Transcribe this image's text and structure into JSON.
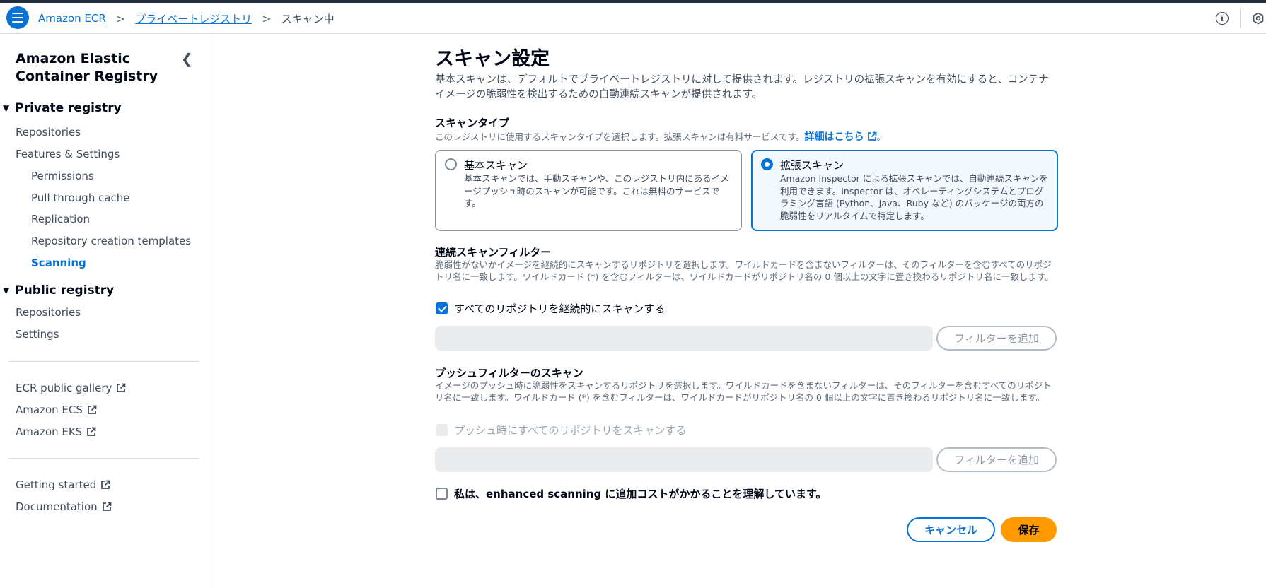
{
  "header": {
    "breadcrumbs": [
      "Amazon ECR",
      "プライベートレジストリ",
      "スキャン中"
    ],
    "separator": ">"
  },
  "sidebar": {
    "title": "Amazon Elastic Container Registry",
    "private_registry": {
      "label": "Private registry",
      "items": [
        "Repositories",
        "Features & Settings"
      ],
      "sub_items": [
        "Permissions",
        "Pull through cache",
        "Replication",
        "Repository creation templates",
        "Scanning"
      ],
      "active": "Scanning"
    },
    "public_registry": {
      "label": "Public registry",
      "items": [
        "Repositories",
        "Settings"
      ]
    },
    "links": [
      "ECR public gallery",
      "Amazon ECS",
      "Amazon EKS"
    ],
    "help_links": [
      "Getting started",
      "Documentation"
    ]
  },
  "main": {
    "title": "スキャン設定",
    "description": "基本スキャンは、デフォルトでプライベートレジストリに対して提供されます。レジストリの拡張スキャンを有効にすると、コンテナイメージの脆弱性を検出するための自動連続スキャンが提供されます。",
    "scan_type": {
      "label": "スキャンタイプ",
      "description": "このレジストリに使用するスキャンタイプを選択します。拡張スキャンは有料サービスです。",
      "learn_more": "詳細はこちら",
      "trailing": "。",
      "options": [
        {
          "title": "基本スキャン",
          "description": "基本スキャンでは、手動スキャンや、このレジストリ内にあるイメージプッシュ時のスキャンが可能です。これは無料のサービスです。",
          "selected": false
        },
        {
          "title": "拡張スキャン",
          "description": "Amazon Inspector による拡張スキャンでは、自動連続スキャンを利用できます。Inspector は、オペレーティングシステムとプログラミング言語 (Python、Java、Ruby など) のパッケージの両方の脆弱性をリアルタイムで特定します。",
          "selected": true
        }
      ]
    },
    "continuous_filter": {
      "label": "連続スキャンフィルター",
      "description": "脆弱性がないかイメージを継続的にスキャンするリポジトリを選択します。ワイルドカードを含まないフィルターは、そのフィルターを含むすべてのリポジトリ名に一致します。ワイルドカード (*) を含むフィルターは、ワイルドカードがリポジトリ名の 0 個以上の文字に置き換わるリポジトリ名に一致します。",
      "checkbox_label": "すべてのリポジトリを継続的にスキャンする",
      "checked": true,
      "add_filter": "フィルターを追加"
    },
    "push_filter": {
      "label": "プッシュフィルターのスキャン",
      "description": "イメージのプッシュ時に脆弱性をスキャンするリポジトリを選択します。ワイルドカードを含まないフィルターは、そのフィルターを含むすべてのリポジトリ名に一致します。ワイルドカード (*) を含むフィルターは、ワイルドカードがリポジトリ名の 0 個以上の文字に置き換わるリポジトリ名に一致します。",
      "checkbox_label": "プッシュ時にすべてのリポジトリをスキャンする",
      "checked": false,
      "add_filter": "フィルターを追加"
    },
    "acknowledge": "私は、enhanced scanning に追加コストがかかることを理解しています。",
    "cancel": "キャンセル",
    "save": "保存"
  },
  "colors": {
    "accent": "#0972d3",
    "primary_button": "#ff9900",
    "topbar_edge": "#232f3e"
  }
}
